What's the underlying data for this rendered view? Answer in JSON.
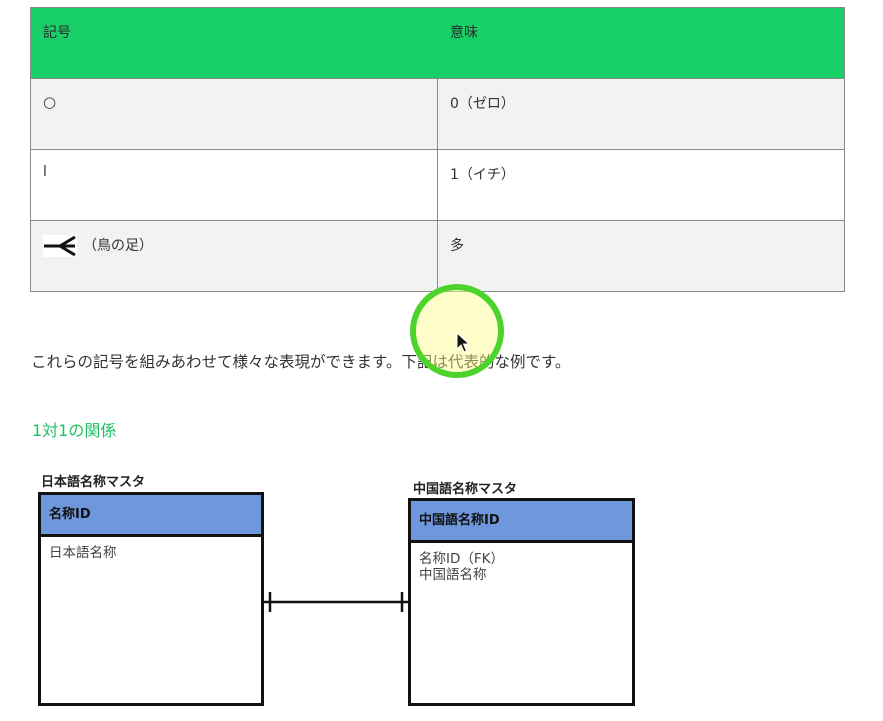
{
  "table": {
    "header": {
      "symbol": "記号",
      "meaning": "意味"
    },
    "rows": [
      {
        "symbol": "○",
        "meaning": "0（ゼロ）"
      },
      {
        "symbol": "l",
        "meaning": "1（イチ）"
      },
      {
        "symbol": "（鳥の足）",
        "meaning": "多",
        "icon": "crows-foot-icon"
      }
    ]
  },
  "intro_text": "これらの記号を組みあわせて様々な表現ができます。下記は代表的な例です。",
  "section_heading": "1対1の関係",
  "diagram": {
    "left_entity": {
      "title": "日本語名称マスタ",
      "primary_key": "名称ID",
      "attributes": [
        "日本語名称"
      ]
    },
    "right_entity": {
      "title": "中国語名称マスタ",
      "primary_key": "中国語名称ID",
      "attributes": [
        "名称ID（FK）",
        "中国語名称"
      ]
    },
    "relationship": "one-to-one"
  },
  "colors": {
    "table_header": "#19cf68",
    "section_heading": "#22c063",
    "entity_header": "#6f97dc",
    "cursor_highlight_ring": "#4cd32c",
    "cursor_highlight_fill": "#fffd8a"
  }
}
